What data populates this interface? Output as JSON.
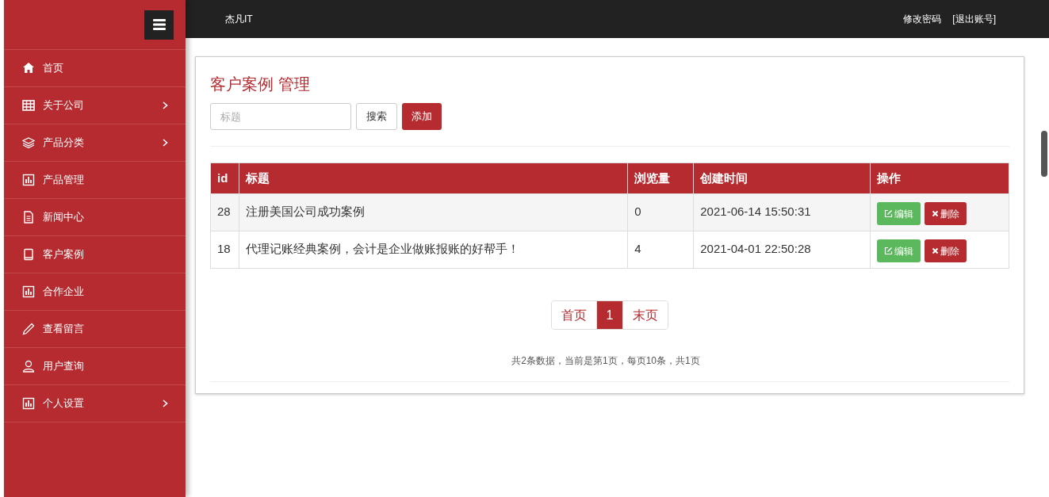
{
  "sidebar": {
    "items": [
      {
        "label": "首页",
        "kind": "home",
        "has_submenu": false
      },
      {
        "label": "关于公司",
        "kind": "table",
        "has_submenu": true
      },
      {
        "label": "产品分类",
        "kind": "layers",
        "has_submenu": true
      },
      {
        "label": "产品管理",
        "kind": "chart",
        "has_submenu": false
      },
      {
        "label": "新闻中心",
        "kind": "document",
        "has_submenu": false
      },
      {
        "label": "客户案例",
        "kind": "book",
        "has_submenu": false
      },
      {
        "label": "合作企业",
        "kind": "chart",
        "has_submenu": false
      },
      {
        "label": "查看留言",
        "kind": "pencil",
        "has_submenu": false
      },
      {
        "label": "用户查询",
        "kind": "user",
        "has_submenu": false
      },
      {
        "label": "个人设置",
        "kind": "chart",
        "has_submenu": true
      }
    ]
  },
  "topbar": {
    "brand": "杰凡IT",
    "links": [
      "修改密码",
      "[退出账号]"
    ]
  },
  "panel": {
    "title": "客户案例 管理",
    "search": {
      "placeholder": "标题"
    },
    "search_button": "搜索",
    "add_button": "添加"
  },
  "table": {
    "columns": [
      "id",
      "标题",
      "浏览量",
      "创建时间",
      "操作"
    ],
    "rows": [
      {
        "cells": [
          "28",
          "注册美国公司成功案例",
          "0",
          "2021-06-14 15:50:31"
        ],
        "actions": [
          "编辑",
          "删除"
        ]
      },
      {
        "cells": [
          "18",
          "代理记账经典案例，会计是企业做账报账的好帮手！",
          "4",
          "2021-04-01 22:50:28"
        ],
        "actions": [
          "编辑",
          "删除"
        ]
      }
    ]
  },
  "pagination": [
    {
      "label": "首页",
      "selected": false
    },
    {
      "label": "1",
      "selected": true
    },
    {
      "label": "末页",
      "selected": false
    }
  ],
  "summary": "共2条数据，当前是第1页，每页10条，共1页"
}
